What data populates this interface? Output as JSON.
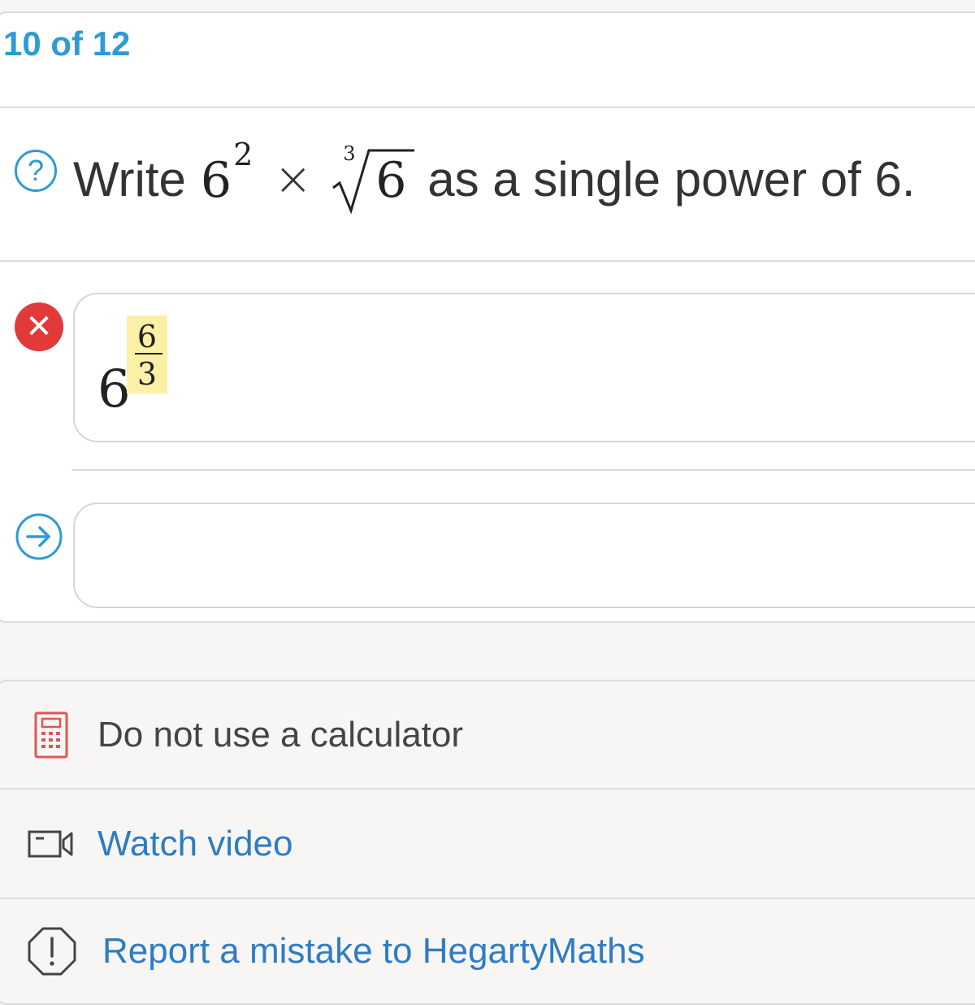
{
  "header": {
    "progress": "10 of 12"
  },
  "question": {
    "lead": "Write",
    "base": "6",
    "exponent": "2",
    "times": "×",
    "root_index": "3",
    "radicand": "6",
    "tail": "as a single power of 6."
  },
  "previous_answer": {
    "status_icon": "✕",
    "base": "6",
    "numerator": "6",
    "denominator": "3",
    "status": "incorrect"
  },
  "answer_input": {
    "value": ""
  },
  "footer": {
    "calculator_note": "Do not use a calculator",
    "watch_video": "Watch video",
    "report": "Report a mistake to HegartyMaths"
  },
  "icons": {
    "help": "question-circle-icon",
    "wrong": "red-x-circle-icon",
    "submit": "arrow-right-circle-icon",
    "calculator": "calculator-icon",
    "video": "video-camera-icon",
    "report": "exclamation-octagon-icon"
  },
  "colors": {
    "accent": "#2e9ad6",
    "error": "#e23a3a",
    "link": "#2e7cc4",
    "highlight": "#fbf1a6",
    "calculator": "#e05555"
  }
}
